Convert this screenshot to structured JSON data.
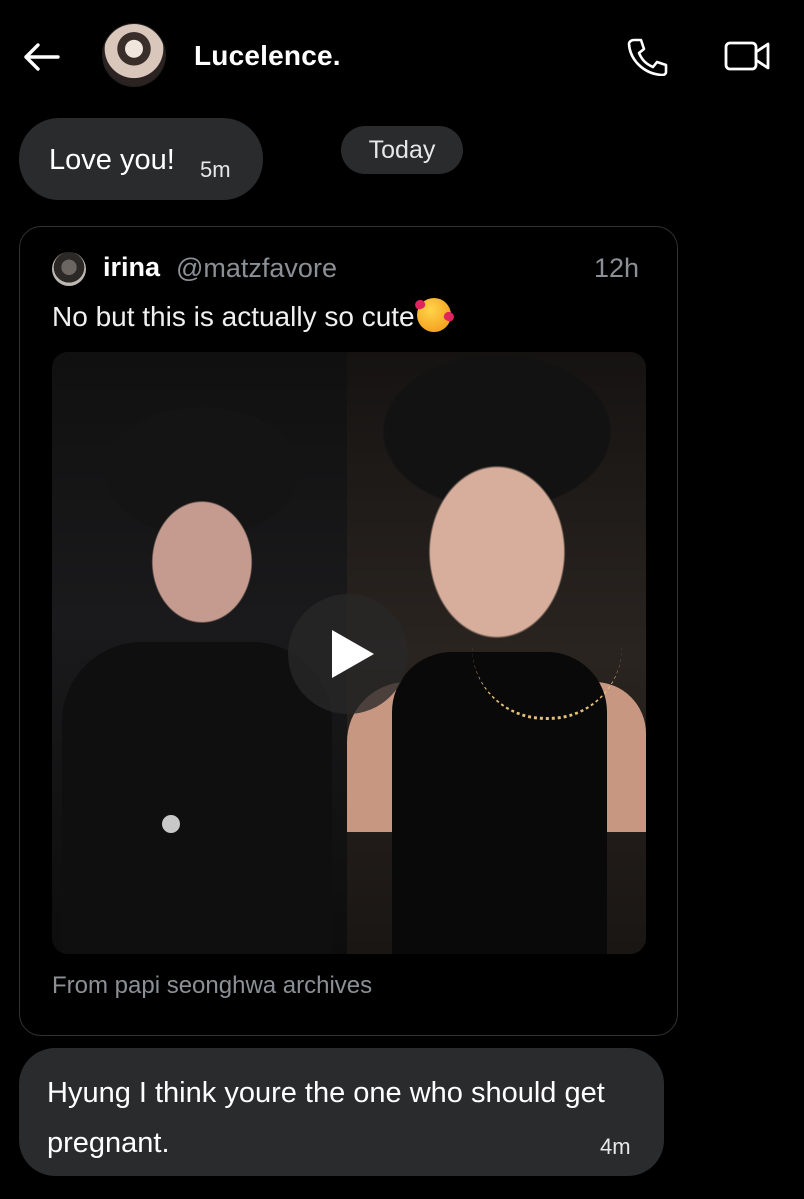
{
  "header": {
    "contact_name": "Lucelence.",
    "back_icon": "arrow-left-icon",
    "call_icon": "phone-icon",
    "video_icon": "video-camera-icon"
  },
  "messages": [
    {
      "text": "Love you!",
      "time": "5m"
    }
  ],
  "date_separator": "Today",
  "quoted_post": {
    "author_name": "irina",
    "author_handle": "@matzfavore",
    "time": "12h",
    "text": "No but this is actually so cute",
    "emoji_icon": "smiling-face-with-hearts-icon",
    "media_type": "video",
    "play_icon": "play-icon",
    "source": "From papi seonghwa archives"
  },
  "reply": {
    "text": "Hyung I think youre the one who should get pregnant.",
    "time": "4m"
  },
  "colors": {
    "background": "#000000",
    "bubble": "#2a2b2d",
    "muted_text": "#8b9096",
    "card_border": "#2f3336"
  }
}
